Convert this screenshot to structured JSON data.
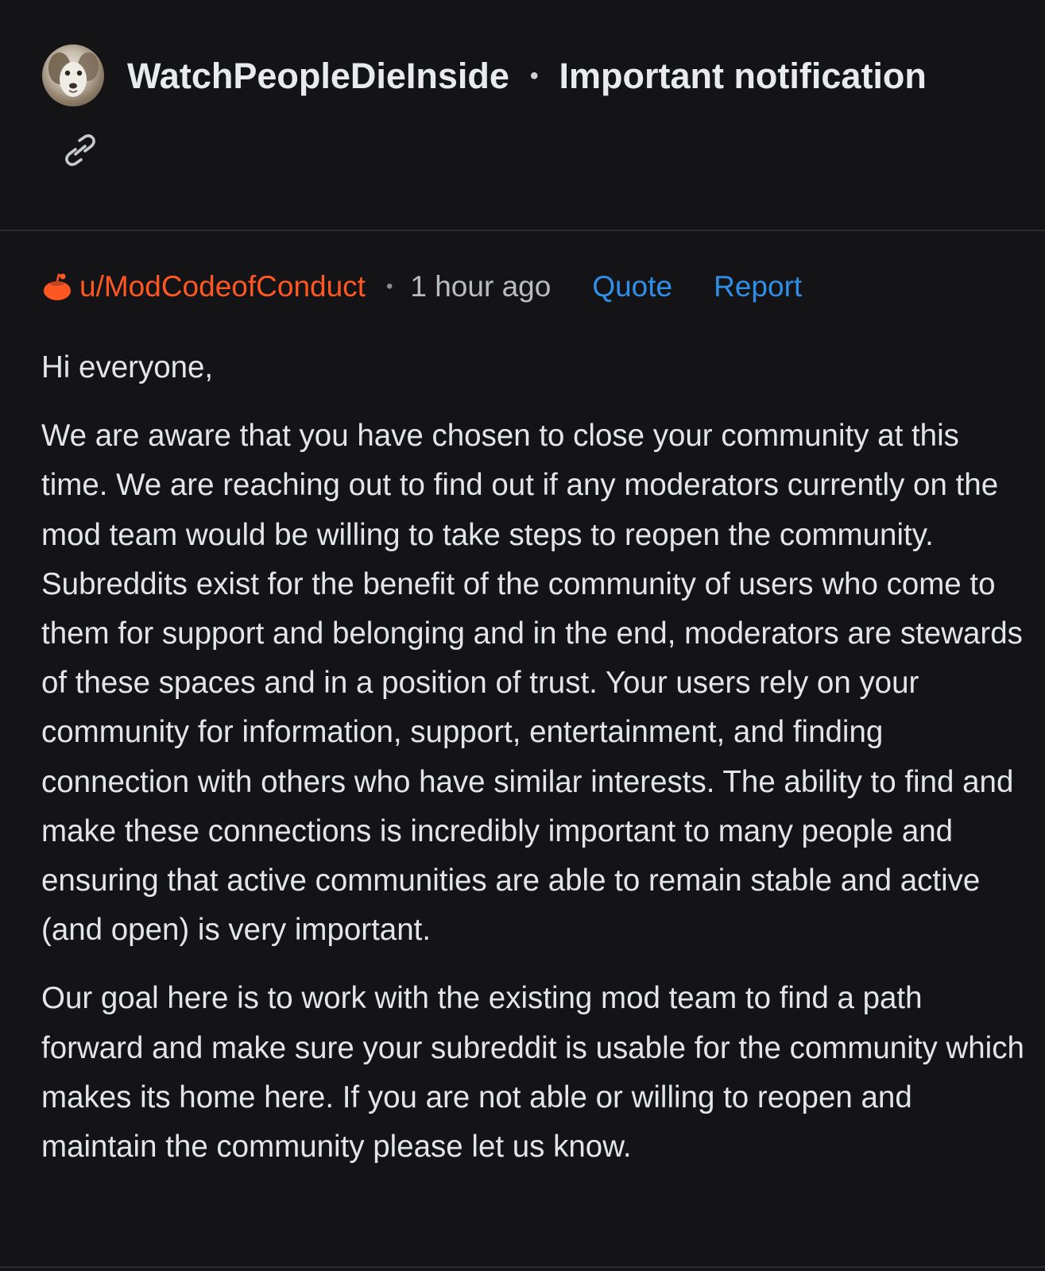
{
  "header": {
    "community": "WatchPeopleDieInside",
    "separator": "•",
    "subject": "Important notification"
  },
  "message": {
    "author": "u/ModCodeofConduct",
    "separator": "•",
    "time": "1 hour ago",
    "quote_label": "Quote",
    "report_label": "Report",
    "paragraphs": [
      "Hi everyone,",
      "We are aware that you have chosen to close your community at this time. We are reaching out to find out if any moderators currently on the mod team would be willing to take steps to reopen the community.  Subreddits exist for the benefit of the community of users who come to them for support and belonging and in the end, moderators are stewards of these spaces and in a position of trust. Your users rely on your community for information, support, entertainment, and finding connection with others who have similar interests. The ability to find and make these connections is incredibly important to many people and ensuring that active communities are able to remain stable and active (and open) is very important.",
      "Our goal here is to work with the existing mod team to find a path forward and make sure your subreddit is usable for the community which makes its home here.  If you are not able or willing to reopen and maintain the community please let us know."
    ]
  },
  "colors": {
    "background": "#141416",
    "username": "#ff5722",
    "link": "#2f8fe8",
    "text": "#e3e5e6"
  },
  "icons": {
    "avatar": "dog-avatar-icon",
    "link": "link-icon",
    "author": "snoo-icon"
  }
}
